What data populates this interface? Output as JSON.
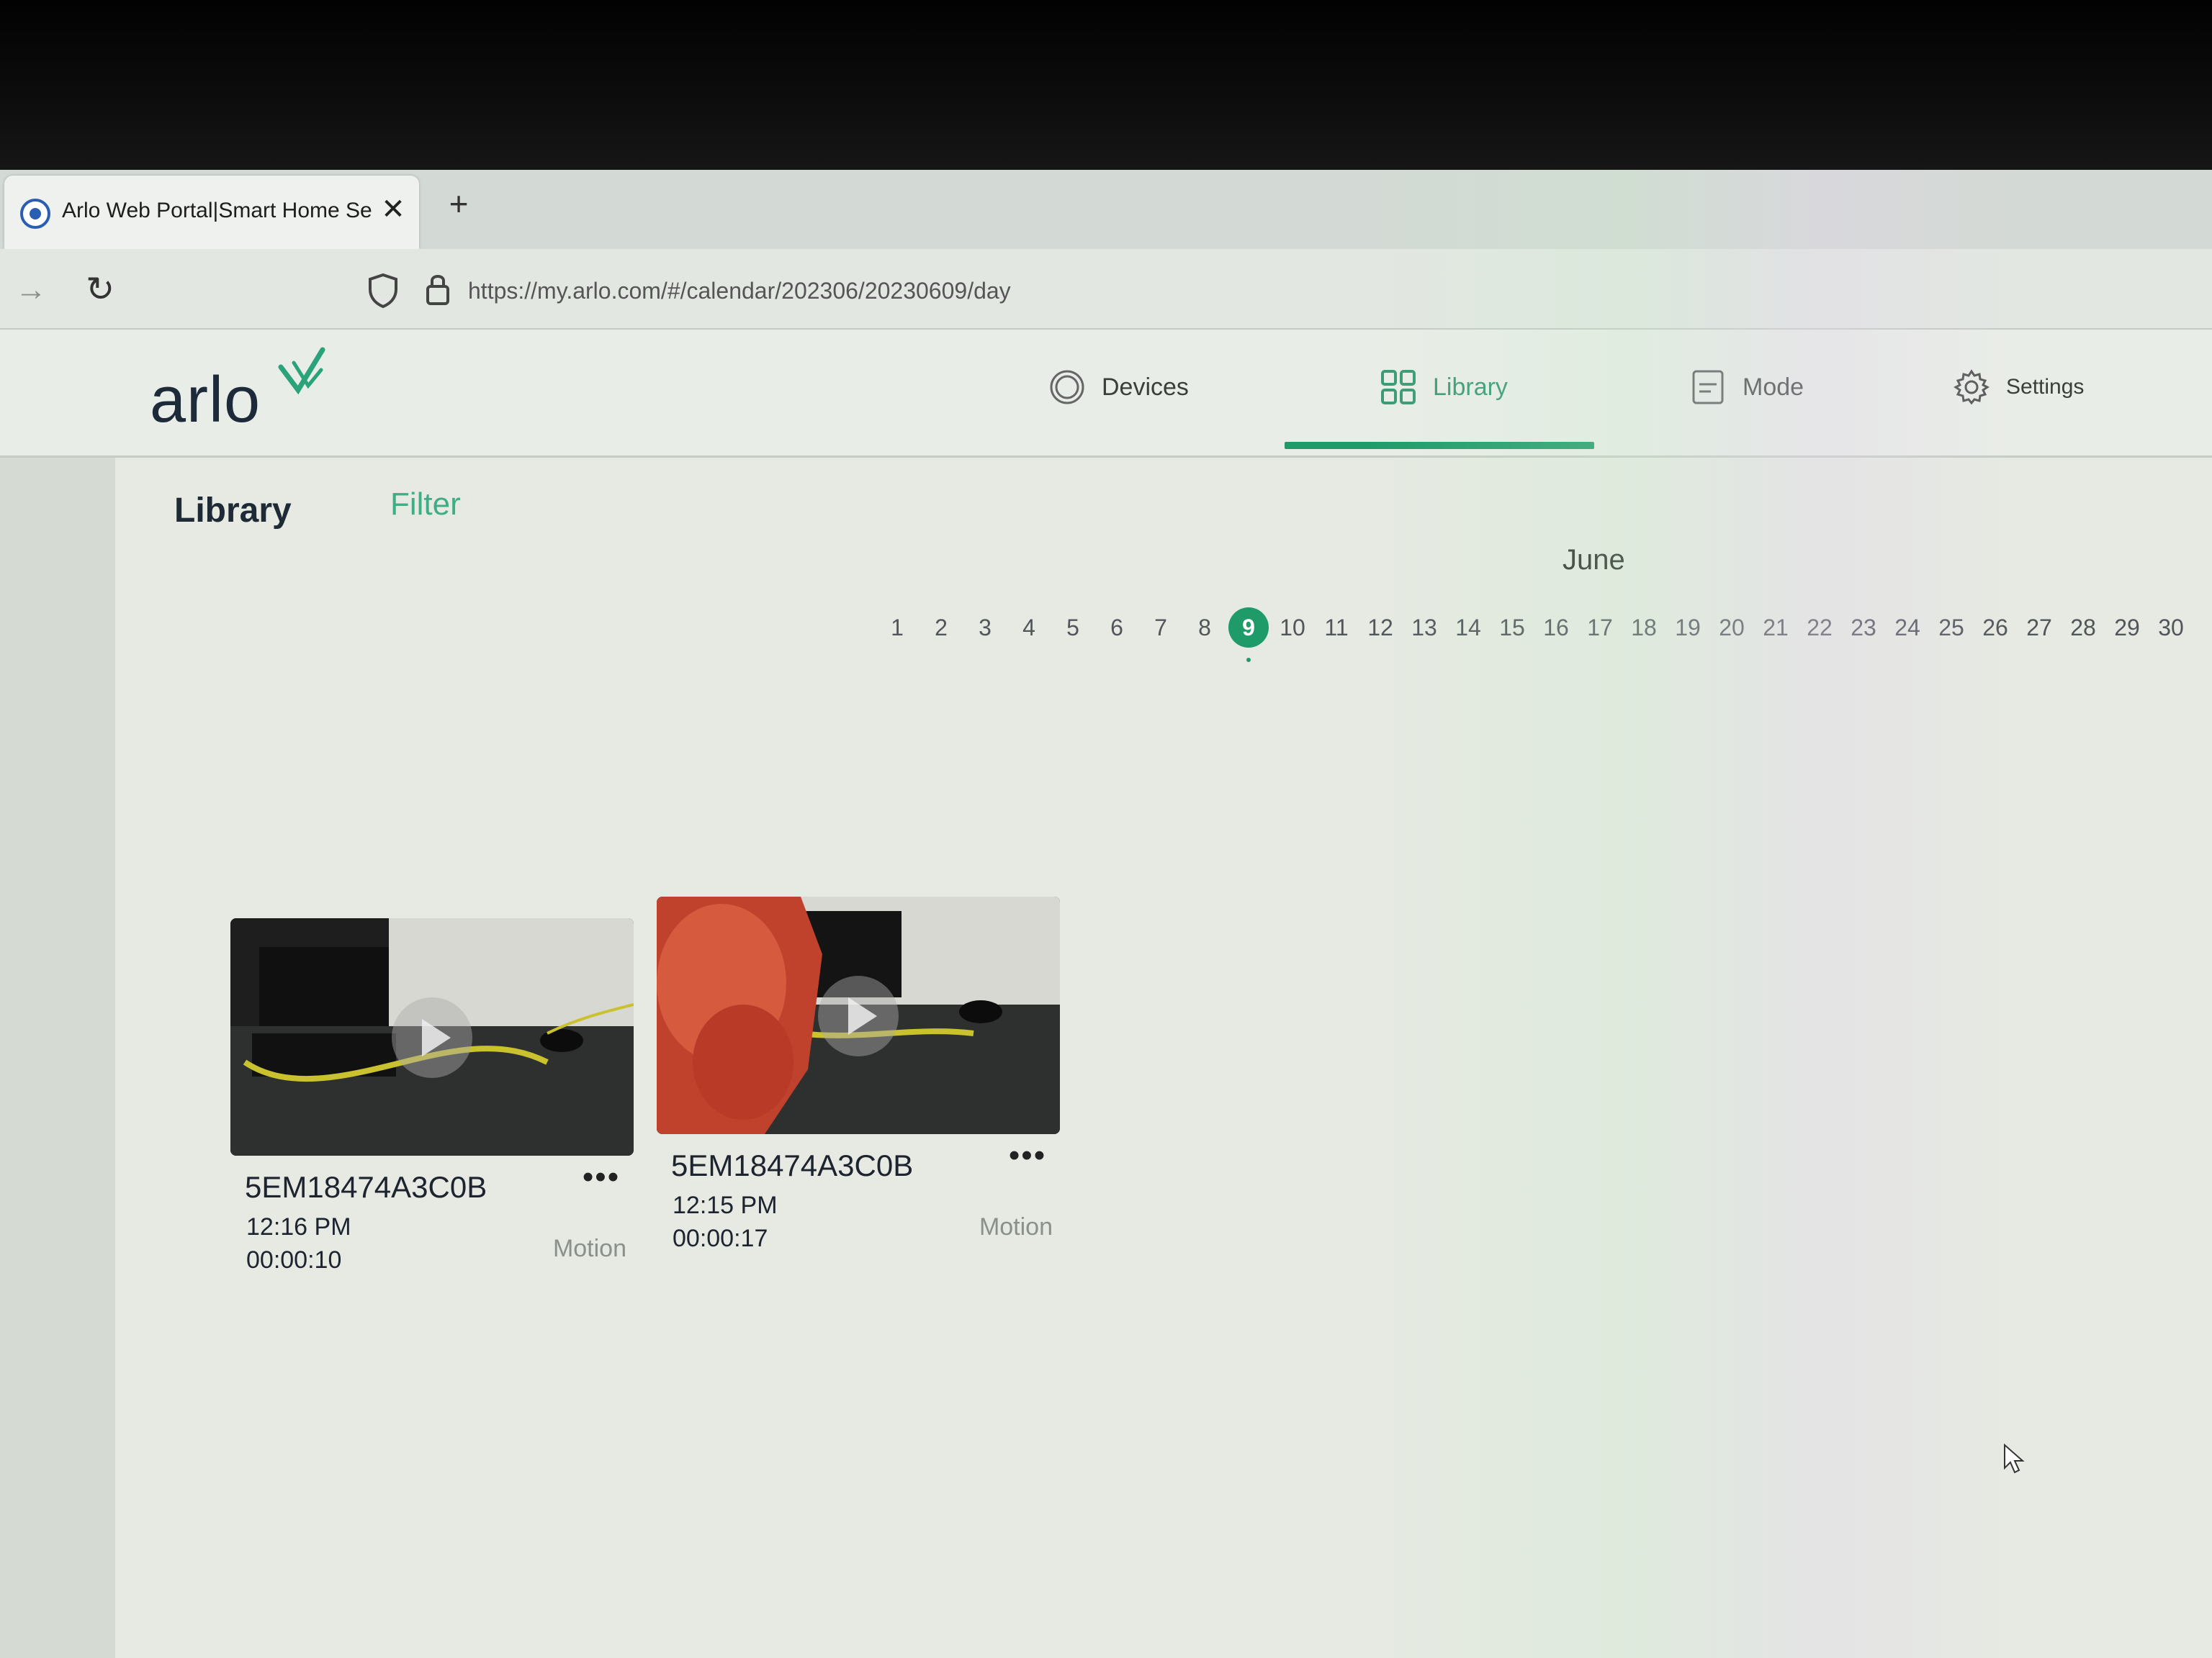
{
  "browser": {
    "tab_title": "Arlo Web Portal|Smart Home Se",
    "tab_close": "✕",
    "new_tab": "+",
    "forward": "→",
    "reload": "↻",
    "url": "https://my.arlo.com/#/calendar/202306/20230609/day"
  },
  "header": {
    "logo": "arlo",
    "nav": {
      "devices": "Devices",
      "library": "Library",
      "mode": "Mode",
      "settings": "Settings"
    },
    "active_tab": "library",
    "accent_color": "#1f9b6a"
  },
  "library": {
    "title": "Library",
    "filter": "Filter",
    "month": "June",
    "days": [
      "1",
      "2",
      "3",
      "4",
      "5",
      "6",
      "7",
      "8",
      "9",
      "10",
      "11",
      "12",
      "13",
      "14",
      "15",
      "16",
      "17",
      "18",
      "19",
      "20",
      "21",
      "22",
      "23",
      "24",
      "25",
      "26",
      "27",
      "28",
      "29",
      "30"
    ],
    "selected_day": "9",
    "clips": [
      {
        "device": "5EM18474A3C0B",
        "time": "12:16 PM",
        "duration": "00:00:10",
        "trigger": "Motion",
        "menu": "•••"
      },
      {
        "device": "5EM18474A3C0B",
        "time": "12:15 PM",
        "duration": "00:00:17",
        "trigger": "Motion",
        "menu": "•••"
      }
    ]
  }
}
